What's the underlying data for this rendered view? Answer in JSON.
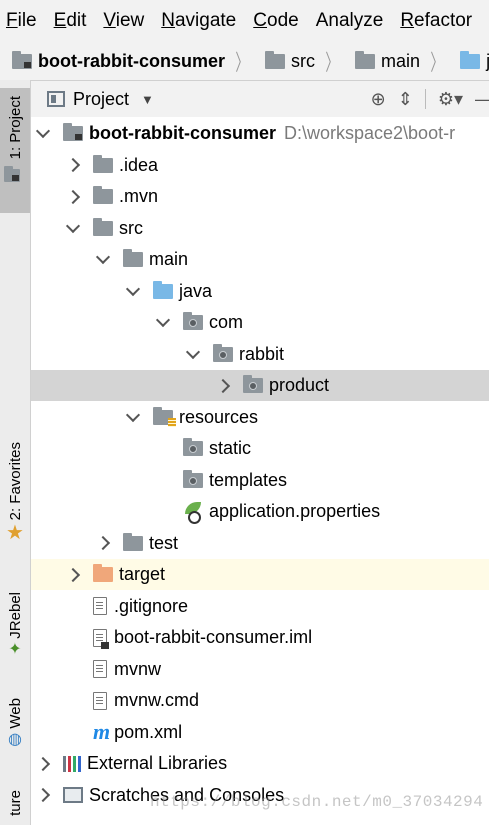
{
  "menu": [
    "File",
    "Edit",
    "View",
    "Navigate",
    "Code",
    "Analyze",
    "Refactor"
  ],
  "menu_mnemonics": [
    "F",
    "E",
    "V",
    "N",
    "C",
    "",
    "R"
  ],
  "breadcrumb": [
    "boot-rabbit-consumer",
    "src",
    "main",
    "java"
  ],
  "panel": {
    "title": "Project",
    "tools": [
      "target-icon",
      "collapse-icon",
      "gear-icon",
      "hide-icon"
    ]
  },
  "side_tabs": [
    "1: Project",
    "2: Favorites",
    "JRebel",
    "Web",
    "ture"
  ],
  "tree": [
    {
      "label": "boot-rabbit-consumer",
      "path": "D:\\workspace2\\boot-r",
      "icon": "module-folder-icon",
      "state": "expanded",
      "depth": 0,
      "bold": true
    },
    {
      "label": ".idea",
      "icon": "folder-icon",
      "state": "collapsed",
      "depth": 1
    },
    {
      "label": ".mvn",
      "icon": "folder-icon",
      "state": "collapsed",
      "depth": 1
    },
    {
      "label": "src",
      "icon": "folder-icon",
      "state": "expanded",
      "depth": 1
    },
    {
      "label": "main",
      "icon": "folder-icon",
      "state": "expanded",
      "depth": 2
    },
    {
      "label": "java",
      "icon": "source-folder-icon",
      "state": "expanded",
      "depth": 3
    },
    {
      "label": "com",
      "icon": "package-icon",
      "state": "expanded",
      "depth": 4
    },
    {
      "label": "rabbit",
      "icon": "package-icon",
      "state": "expanded",
      "depth": 5
    },
    {
      "label": "product",
      "icon": "package-icon",
      "state": "collapsed",
      "depth": 6,
      "selected": true
    },
    {
      "label": "resources",
      "icon": "resources-folder-icon",
      "state": "expanded",
      "depth": 3
    },
    {
      "label": "static",
      "icon": "package-icon",
      "state": "none",
      "depth": 4
    },
    {
      "label": "templates",
      "icon": "package-icon",
      "state": "none",
      "depth": 4
    },
    {
      "label": "application.properties",
      "icon": "spring-properties-icon",
      "state": "none",
      "depth": 4
    },
    {
      "label": "test",
      "icon": "folder-icon",
      "state": "collapsed",
      "depth": 2
    },
    {
      "label": "target",
      "icon": "excluded-folder-icon",
      "state": "collapsed",
      "depth": 1,
      "highlight": true
    },
    {
      "label": ".gitignore",
      "icon": "file-icon",
      "state": "none",
      "depth": 1
    },
    {
      "label": "boot-rabbit-consumer.iml",
      "icon": "iml-file-icon",
      "state": "none",
      "depth": 1
    },
    {
      "label": "mvnw",
      "icon": "file-icon",
      "state": "none",
      "depth": 1
    },
    {
      "label": "mvnw.cmd",
      "icon": "file-icon",
      "state": "none",
      "depth": 1
    },
    {
      "label": "pom.xml",
      "icon": "maven-icon",
      "state": "none",
      "depth": 1
    },
    {
      "label": "External Libraries",
      "icon": "libraries-icon",
      "state": "collapsed",
      "depth": 0
    },
    {
      "label": "Scratches and Consoles",
      "icon": "scratches-icon",
      "state": "collapsed",
      "depth": 0
    }
  ],
  "watermark": "https://blog.csdn.net/m0_37034294"
}
